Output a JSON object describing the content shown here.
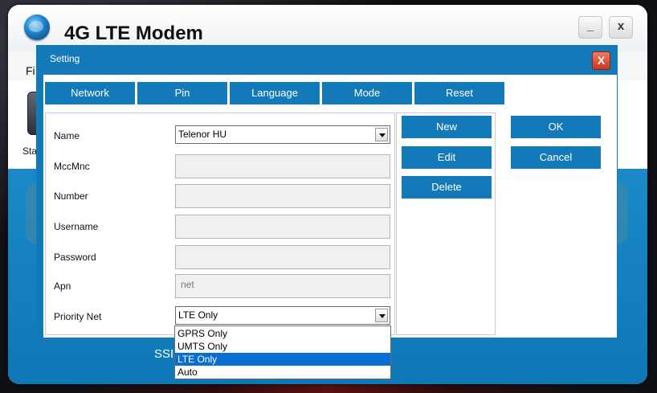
{
  "app": {
    "title": "4G LTE Modem",
    "minimize_label": "_",
    "close_label": "x",
    "menu_file": "Fi",
    "toolbar_icon_label": "Sta",
    "ssid_label": "SSI"
  },
  "dialog": {
    "title": "Setting",
    "close_label": "X",
    "tabs": [
      "Network",
      "Pin",
      "Language",
      "Mode",
      "Reset"
    ],
    "fields": {
      "name": {
        "label": "Name",
        "value": "Telenor HU"
      },
      "mccmnc": {
        "label": "MccMnc",
        "value": ""
      },
      "number": {
        "label": "Number",
        "value": ""
      },
      "username": {
        "label": "Username",
        "value": ""
      },
      "password": {
        "label": "Password",
        "value": ""
      },
      "apn": {
        "label": "Apn",
        "value": "net"
      },
      "priority_net": {
        "label": "Priority Net",
        "value": "LTE Only"
      }
    },
    "priority_options": [
      "GPRS Only",
      "UMTS Only",
      "LTE Only",
      "Auto"
    ],
    "priority_selected_index": 2,
    "actions": {
      "new": "New",
      "edit": "Edit",
      "delete": "Delete"
    },
    "ok_label": "OK",
    "cancel_label": "Cancel"
  },
  "colors": {
    "accent_blue": "#1479b8",
    "selection_blue": "#0a6ed1",
    "close_red": "#c8381d"
  }
}
